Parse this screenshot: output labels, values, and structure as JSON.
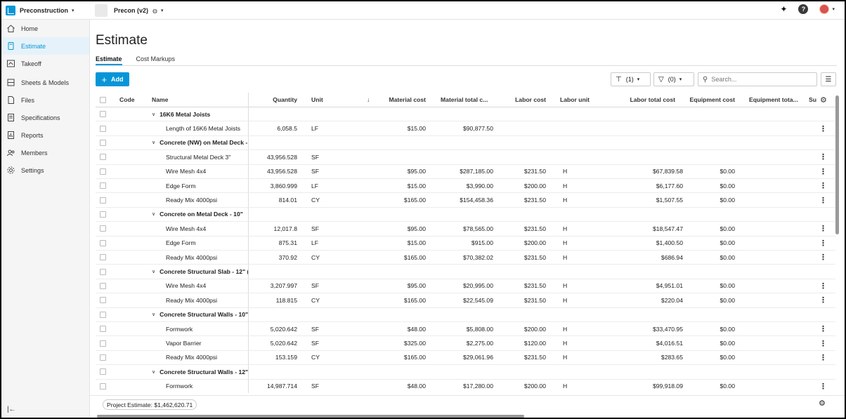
{
  "app": {
    "name": "Preconstruction",
    "project": "Precon (v2)"
  },
  "sidebar": {
    "items": [
      {
        "label": "Home",
        "icon": "home-icon"
      },
      {
        "label": "Estimate",
        "icon": "calculator-icon",
        "active": true
      },
      {
        "label": "Takeoff",
        "icon": "takeoff-icon"
      },
      {
        "label": "Sheets & Models",
        "icon": "sheets-icon"
      },
      {
        "label": "Files",
        "icon": "file-icon"
      },
      {
        "label": "Specifications",
        "icon": "specifications-icon"
      },
      {
        "label": "Reports",
        "icon": "reports-icon"
      },
      {
        "label": "Members",
        "icon": "members-icon"
      },
      {
        "label": "Settings",
        "icon": "gear-icon"
      }
    ]
  },
  "page": {
    "title": "Estimate",
    "tabs": [
      {
        "label": "Estimate",
        "active": true
      },
      {
        "label": "Cost Markups"
      }
    ]
  },
  "toolbar": {
    "add_label": "Add",
    "group_count": "(1)",
    "filter_count": "(0)",
    "search_placeholder": "Search..."
  },
  "table": {
    "headers": {
      "code": "Code",
      "name": "Name",
      "quantity": "Quantity",
      "unit": "Unit",
      "material_cost": "Material cost",
      "material_total": "Material total c...",
      "labor_cost": "Labor cost",
      "labor_unit": "Labor unit",
      "labor_total": "Labor total cost",
      "equipment_cost": "Equipment cost",
      "equipment_total": "Equipment tota...",
      "extra": "Su"
    },
    "rows": [
      {
        "group": true,
        "name": "16K6 Metal Joists"
      },
      {
        "name": "Length of 16K6 Metal Joists",
        "quantity": "6,058.5",
        "unit": "LF",
        "material_cost": "$15.00",
        "material_total": "$90,877.50",
        "labor_cost": "",
        "labor_unit": "",
        "labor_total": "",
        "equipment_cost": ""
      },
      {
        "group": true,
        "name": "Concrete (NW) on Metal Deck - ..."
      },
      {
        "name": "Structural Metal Deck 3\"",
        "quantity": "43,956.528",
        "unit": "SF",
        "material_cost": "",
        "material_total": "",
        "labor_cost": "",
        "labor_unit": "",
        "labor_total": "",
        "equipment_cost": ""
      },
      {
        "name": "Wire Mesh 4x4",
        "quantity": "43,956.528",
        "unit": "SF",
        "material_cost": "$95.00",
        "material_total": "$287,185.00",
        "labor_cost": "$231.50",
        "labor_unit": "H",
        "labor_total": "$67,839.58",
        "equipment_cost": "$0.00"
      },
      {
        "name": "Edge Form",
        "quantity": "3,860.999",
        "unit": "LF",
        "material_cost": "$15.00",
        "material_total": "$3,990.00",
        "labor_cost": "$200.00",
        "labor_unit": "H",
        "labor_total": "$6,177.60",
        "equipment_cost": "$0.00"
      },
      {
        "name": "Ready Mix 4000psi",
        "quantity": "814.01",
        "unit": "CY",
        "material_cost": "$165.00",
        "material_total": "$154,458.36",
        "labor_cost": "$231.50",
        "labor_unit": "H",
        "labor_total": "$1,507.55",
        "equipment_cost": "$0.00"
      },
      {
        "group": true,
        "name": "Concrete on Metal Deck - 10\""
      },
      {
        "name": "Wire Mesh 4x4",
        "quantity": "12,017.8",
        "unit": "SF",
        "material_cost": "$95.00",
        "material_total": "$78,565.00",
        "labor_cost": "$231.50",
        "labor_unit": "H",
        "labor_total": "$18,547.47",
        "equipment_cost": "$0.00"
      },
      {
        "name": "Edge Form",
        "quantity": "875.31",
        "unit": "LF",
        "material_cost": "$15.00",
        "material_total": "$915.00",
        "labor_cost": "$200.00",
        "labor_unit": "H",
        "labor_total": "$1,400.50",
        "equipment_cost": "$0.00"
      },
      {
        "name": "Ready Mix 4000psi",
        "quantity": "370.92",
        "unit": "CY",
        "material_cost": "$165.00",
        "material_total": "$70,382.02",
        "labor_cost": "$231.50",
        "labor_unit": "H",
        "labor_total": "$686.94",
        "equipment_cost": "$0.00"
      },
      {
        "group": true,
        "name": "Concrete Structural Slab - 12\" (..."
      },
      {
        "name": "Wire Mesh 4x4",
        "quantity": "3,207.997",
        "unit": "SF",
        "material_cost": "$95.00",
        "material_total": "$20,995.00",
        "labor_cost": "$231.50",
        "labor_unit": "H",
        "labor_total": "$4,951.01",
        "equipment_cost": "$0.00"
      },
      {
        "name": "Ready Mix 4000psi",
        "quantity": "118.815",
        "unit": "CY",
        "material_cost": "$165.00",
        "material_total": "$22,545.09",
        "labor_cost": "$231.50",
        "labor_unit": "H",
        "labor_total": "$220.04",
        "equipment_cost": "$0.00"
      },
      {
        "group": true,
        "name": "Concrete Structural Walls - 10\""
      },
      {
        "name": "Formwork",
        "quantity": "5,020.642",
        "unit": "SF",
        "material_cost": "$48.00",
        "material_total": "$5,808.00",
        "labor_cost": "$200.00",
        "labor_unit": "H",
        "labor_total": "$33,470.95",
        "equipment_cost": "$0.00"
      },
      {
        "name": "Vapor Barrier",
        "quantity": "5,020.642",
        "unit": "SF",
        "material_cost": "$325.00",
        "material_total": "$2,275.00",
        "labor_cost": "$120.00",
        "labor_unit": "H",
        "labor_total": "$4,016.51",
        "equipment_cost": "$0.00"
      },
      {
        "name": "Ready Mix 4000psi",
        "quantity": "153.159",
        "unit": "CY",
        "material_cost": "$165.00",
        "material_total": "$29,061.96",
        "labor_cost": "$231.50",
        "labor_unit": "H",
        "labor_total": "$283.65",
        "equipment_cost": "$0.00"
      },
      {
        "group": true,
        "name": "Concrete Structural Walls - 12\""
      },
      {
        "name": "Formwork",
        "quantity": "14,987.714",
        "unit": "SF",
        "material_cost": "$48.00",
        "material_total": "$17,280.00",
        "labor_cost": "$200.00",
        "labor_unit": "H",
        "labor_total": "$99,918.09",
        "equipment_cost": "$0.00"
      }
    ]
  },
  "footer": {
    "summary": "Project Estimate: $1,462,620.71"
  },
  "colors": {
    "accent": "#0696d7",
    "sidebar_bg": "#f5f5f5",
    "active_bg": "#e6f2fa"
  }
}
